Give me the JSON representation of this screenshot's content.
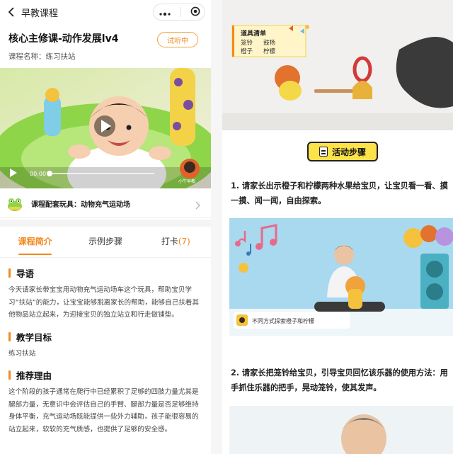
{
  "nav": {
    "title": "早教课程"
  },
  "course": {
    "title": "核心主修课-动作发展lv4",
    "subtitle": "课程名称：练习扶站",
    "trial_label": "试听中"
  },
  "video": {
    "time": "00:00",
    "watermark": "小牛早教"
  },
  "toy": {
    "label": "课程配套玩具：",
    "name": "动物充气运动场"
  },
  "tabs": [
    {
      "label": "课程简介",
      "active": true
    },
    {
      "label": "示例步骤",
      "active": false
    },
    {
      "label": "打卡",
      "count": "(7)",
      "active": false
    }
  ],
  "sections": {
    "intro": {
      "heading": "导语",
      "body": "今天请家长带宝宝用动物充气运动场车这个玩具，帮助宝贝学习“扶站”的能力，让宝宝能够脱离家长的帮助，能够自己扶着其他物品站立起来，为迎接宝贝的独立站立和行走做铺垫。"
    },
    "goal": {
      "heading": "教学目标",
      "body": "练习扶站"
    },
    "reason": {
      "heading": "推荐理由",
      "body": "这个阶段的孩子通常在爬行中已经累积了足够的四肢力量尤其是腿部力量，无意识中会评估自己的手臂、腿部力量是否足够维持身体平衡，充气运动场既能提供一些外力辅助，孩子能很容易的站立起来，软软的充气质感，也提供了足够的安全感。"
    }
  },
  "right": {
    "props": {
      "title": "道具清单",
      "items": [
        "笼铃",
        "鼓杨",
        "橙子",
        "柠檬"
      ]
    },
    "badge": "活动步骤",
    "step1": "1. 请家长出示橙子和柠檬两种水果给宝贝，让宝贝看一看、摸一摸、闻一闻，自由探索。",
    "caption": "不同方式探索橙子和柠檬",
    "step2": "2. 请家长把笼铃给宝贝，引导宝贝回忆该乐器的使用方法：用手抓住乐器的把手，晃动笼铃，使其发声。"
  },
  "colors": {
    "accent": "#f08a1d",
    "badge": "#fde24a",
    "sky": "#a9d9ef"
  }
}
